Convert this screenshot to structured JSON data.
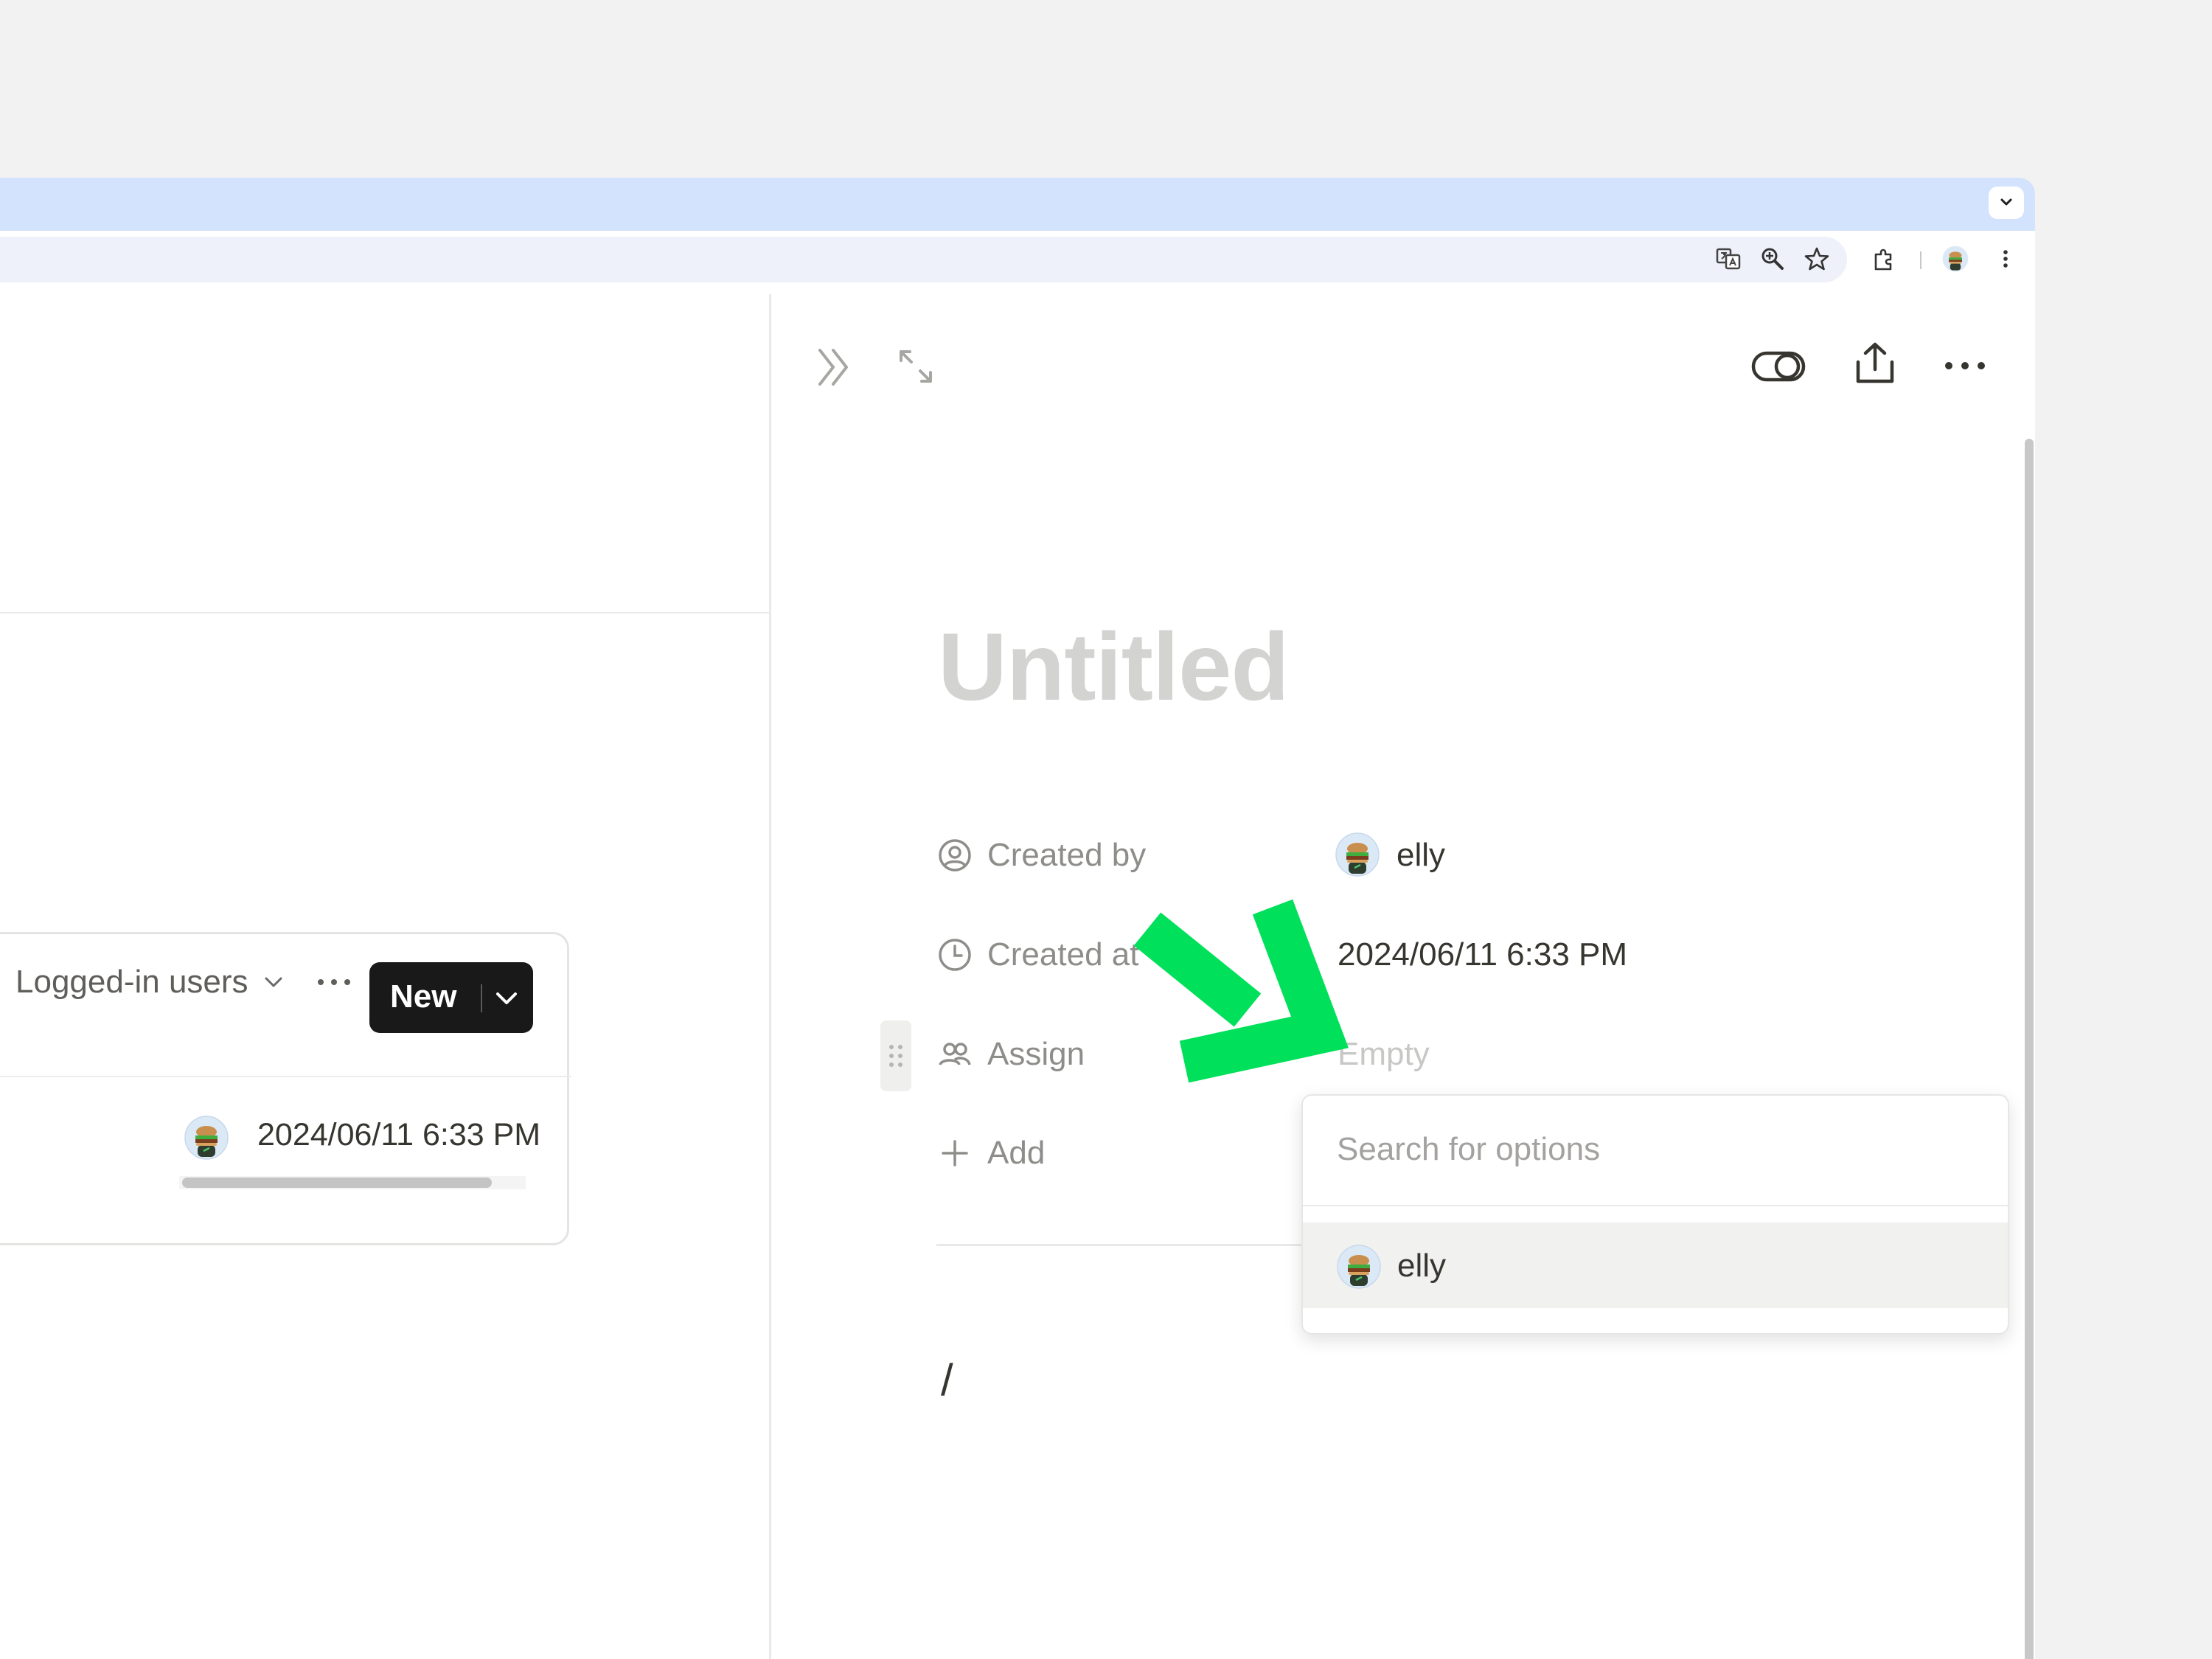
{
  "browser": {
    "toolbar_icons": [
      "translate-icon",
      "zoom-icon",
      "bookmark-star-icon",
      "extensions-icon",
      "profile-avatar",
      "menu-kebab-icon"
    ]
  },
  "database_view": {
    "filter_label": "Logged-in users",
    "new_button_label": "New",
    "row": {
      "created_time": "2024/06/11 6:33 PM"
    }
  },
  "peek_panel": {
    "header_icons": [
      "collapse-panel-icon",
      "expand-icon",
      "toggle-icon",
      "share-icon",
      "more-icon"
    ],
    "title_placeholder": "Untitled",
    "properties": [
      {
        "icon": "person-circle-icon",
        "label": "Created by",
        "value": "elly"
      },
      {
        "icon": "clock-icon",
        "label": "Created at",
        "value": "2024/06/11 6:33 PM"
      },
      {
        "icon": "people-icon",
        "label": "Assign",
        "value": "Empty"
      }
    ],
    "add_property_label": "Add",
    "body_text": "/"
  },
  "assign_dropdown": {
    "search_placeholder": "Search for options",
    "options": [
      {
        "label": "elly"
      }
    ]
  },
  "annotation": {
    "arrow_color": "#00e05a"
  },
  "colors": {
    "accent_dark": "#191919",
    "tabstrip": "#d3e3fd"
  }
}
